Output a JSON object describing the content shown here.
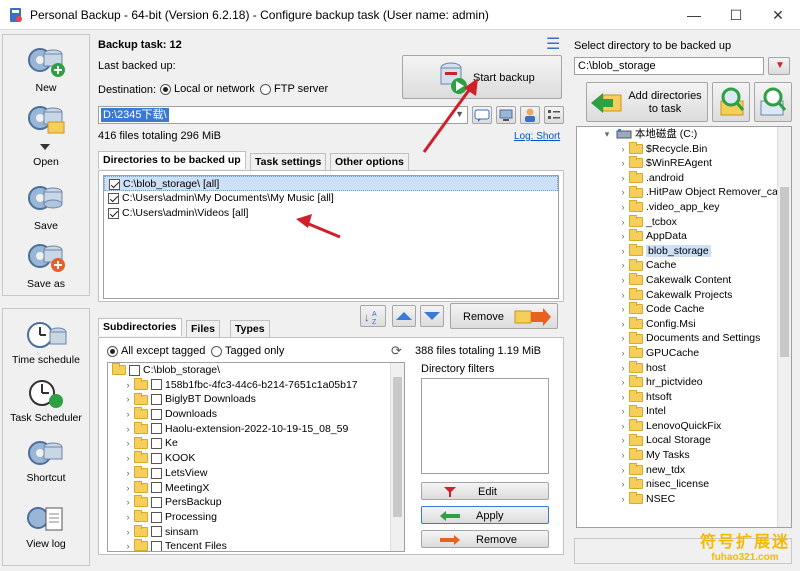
{
  "window": {
    "title": "Personal Backup - 64-bit (Version 6.2.18) - Configure backup task (User name: admin)",
    "minimize": "—",
    "maximize": "☐",
    "close": "✕"
  },
  "sidebar": {
    "items": [
      {
        "label": "New",
        "icon": "new-task-icon"
      },
      {
        "label": "Open",
        "icon": "open-task-icon"
      },
      {
        "label": "Save",
        "icon": "save-task-icon"
      },
      {
        "label": "Save as",
        "icon": "save-as-icon"
      },
      {
        "label": "Time schedule",
        "icon": "time-schedule-icon"
      },
      {
        "label": "Task Scheduler",
        "icon": "task-scheduler-icon"
      },
      {
        "label": "Shortcut",
        "icon": "shortcut-icon"
      },
      {
        "label": "View log",
        "icon": "view-log-icon"
      }
    ]
  },
  "task": {
    "backup_task_label": "Backup task: 12",
    "last_backed_up_label": "Last backed up:",
    "destination_label": "Destination:",
    "dest_local": "Local or network",
    "dest_ftp": "FTP server",
    "start_backup": "Start backup",
    "destination_path": "D:\\2345下载\\",
    "files_summary": "416 files totaling 296 MiB",
    "log_link": "Log: Short"
  },
  "tabs": {
    "dirs": "Directories to be backed up",
    "task_settings": "Task settings",
    "other_options": "Other options"
  },
  "backup_dirs": [
    {
      "path": "C:\\blob_storage\\ [all]",
      "checked": true,
      "selected": true
    },
    {
      "path": "C:\\Users\\admin\\My Documents\\My Music [all]",
      "checked": true,
      "selected": false
    },
    {
      "path": "C:\\Users\\admin\\Videos [all]",
      "checked": true,
      "selected": false
    }
  ],
  "remove_button": "Remove",
  "subtabs": {
    "subdirectories": "Subdirectories",
    "files": "Files",
    "types": "Types"
  },
  "filter": {
    "all_except": "All except tagged",
    "tagged_only": "Tagged only",
    "summary": "388 files totaling 1.19 MiB"
  },
  "subdirs": {
    "root": "C:\\blob_storage\\",
    "items": [
      "158b1fbc-4fc3-44c6-b214-7651c1a05b17",
      "BiglyBT Downloads",
      "Downloads",
      "Haolu-extension-2022-10-19-15_08_59",
      "Ke",
      "KOOK",
      "LetsView",
      "MeetingX",
      "PersBackup",
      "Processing",
      "sinsam",
      "Tencent Files"
    ]
  },
  "dir_filters": {
    "title": "Directory filters",
    "edit": "Edit",
    "apply": "Apply",
    "remove": "Remove"
  },
  "right_panel": {
    "select_label": "Select directory to be backed up",
    "path_value": "C:\\blob_storage",
    "add_dirs_line1": "Add directories",
    "add_dirs_line2": "to task",
    "drive_label": "本地磁盘 (C:)",
    "tree": [
      "$Recycle.Bin",
      "$WinREAgent",
      ".android",
      ".HitPaw Object Remover_ca",
      ".video_app_key",
      "_tcbox",
      "AppData",
      "blob_storage",
      "Cache",
      "Cakewalk Content",
      "Cakewalk Projects",
      "Code Cache",
      "Config.Msi",
      "Documents and Settings",
      "GPUCache",
      "host",
      "hr_pictvideo",
      "htsoft",
      "Intel",
      "LenovoQuickFix",
      "Local Storage",
      "My Tasks",
      "new_tdx",
      "nisec_license",
      "NSEC"
    ],
    "selected_index": 7
  },
  "watermark": {
    "line1": "符号扩展迷",
    "line2": "fuhao321.com"
  },
  "colors": {
    "accent_red": "#d0212a",
    "selection_blue": "#cce0f7",
    "folder_yellow": "#f6cf5a",
    "watermark_gold": "#f5b900"
  }
}
